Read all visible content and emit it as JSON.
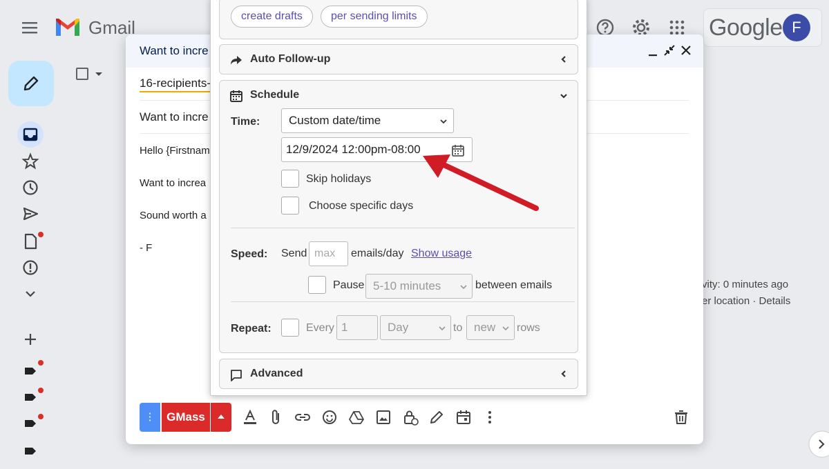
{
  "app": {
    "brand": "Gmail",
    "google_logo": "Google",
    "avatar_letter": "F",
    "colors": {
      "gmass_red": "#db2a2a",
      "compose_blue": "#c2e7ff",
      "link_purple": "#5a4fb0",
      "arrow_red": "#d01c25"
    }
  },
  "compose": {
    "title": "Want to incre",
    "to": "16-recipients-",
    "subject": "Want to incre",
    "body_lines": [
      "Hello {Firstnam",
      "Want to increa",
      "Sound worth a",
      "- F"
    ],
    "send_button": "GMass",
    "dots_label": "⋮"
  },
  "background_right": {
    "activity": "vity: 0 minutes ago",
    "location": "er location · Details"
  },
  "panel": {
    "chips": [
      "create drafts",
      "per sending limits"
    ],
    "auto_followup": {
      "title": "Auto Follow-up"
    },
    "schedule": {
      "title": "Schedule",
      "time_label": "Time:",
      "time_option": "Custom date/time",
      "datetime_value": "12/9/2024 12:00pm-08:00",
      "skip_holidays": "Skip holidays",
      "choose_days": "Choose specific days",
      "speed_label": "Speed:",
      "send_label": "Send",
      "max_placeholder": "max",
      "emails_day": "emails/day",
      "show_usage": "Show usage",
      "pause_label": "Pause",
      "pause_option": "5-10 minutes",
      "between": "between emails",
      "repeat_label": "Repeat:",
      "every_label": "Every",
      "every_value": "1",
      "unit_option": "Day",
      "to_label": "to",
      "new_option": "new",
      "rows_label": "rows"
    },
    "advanced": {
      "title": "Advanced"
    }
  }
}
